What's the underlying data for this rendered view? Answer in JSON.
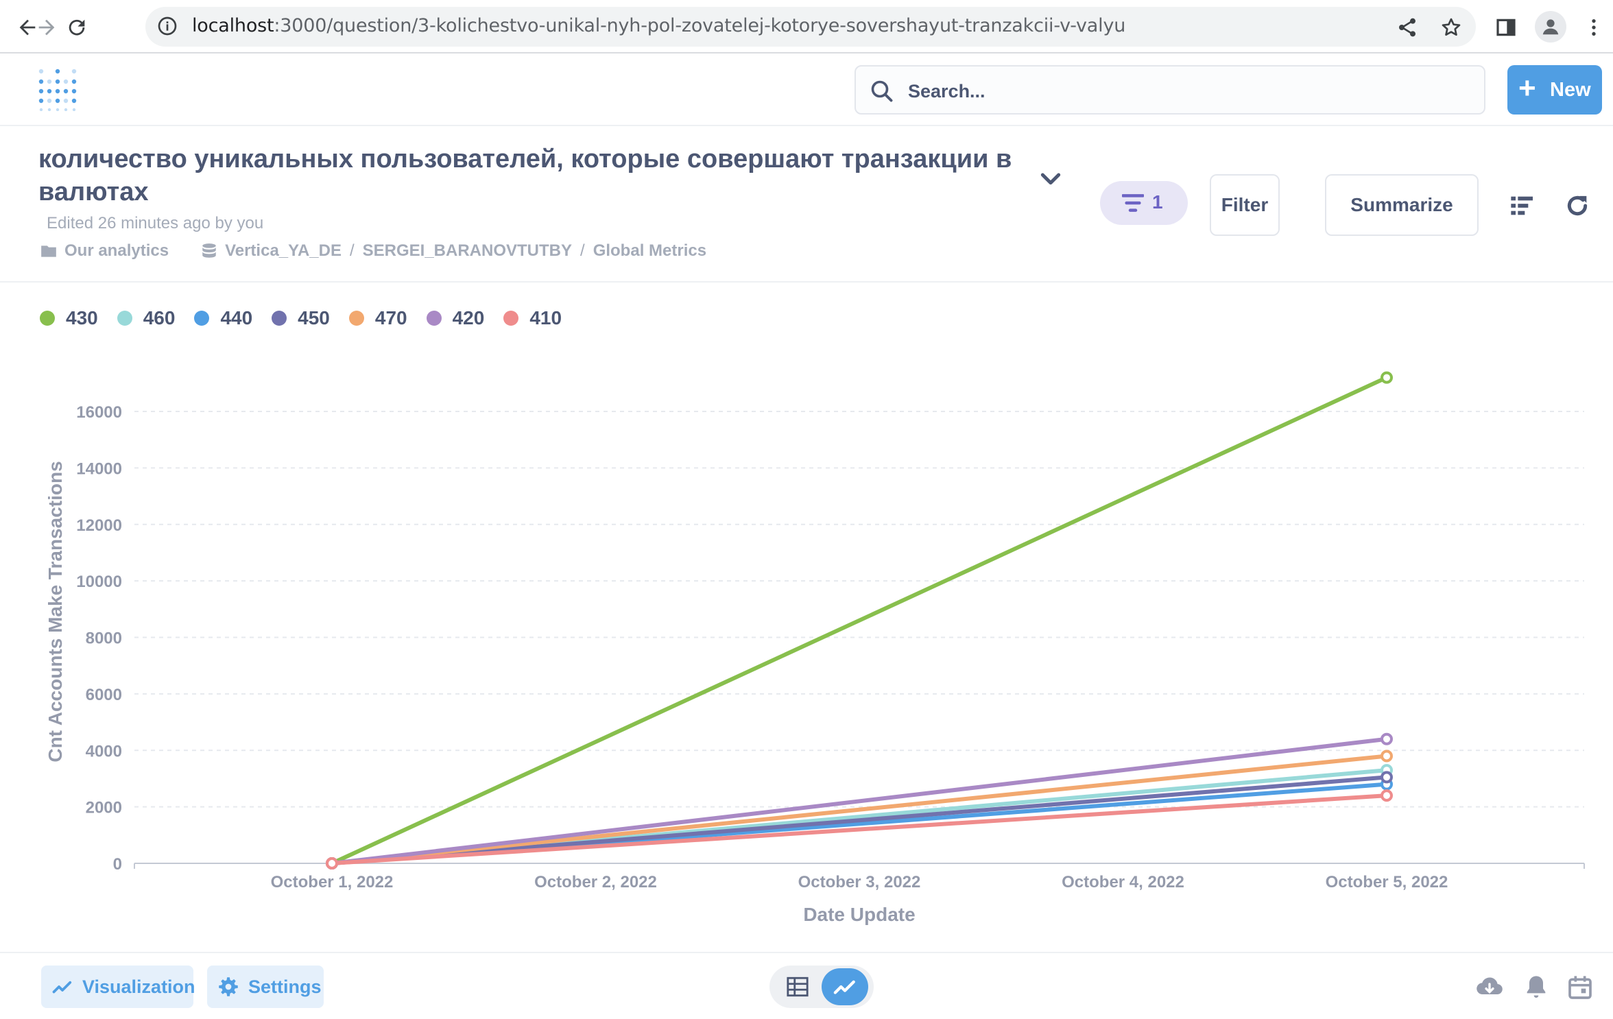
{
  "browser": {
    "url_host": "localhost",
    "url_rest": ":3000/question/3-kolichestvo-unikal-nyh-pol-zovatelej-kotorye-sovershayut-tranzakcii-v-valyu"
  },
  "app": {
    "search_placeholder": "Search...",
    "new_label": "New",
    "new_plus": "+"
  },
  "question": {
    "title": "количество уникальных пользователей, которые совершают транзакции в валютах",
    "edited": "Edited 26 minutes ago by you",
    "collection": "Our analytics",
    "database": "Vertica_YA_DE",
    "sep1": "/",
    "schema": "SERGEI_BARANOVTUTBY",
    "sep2": "/",
    "table": "Global Metrics",
    "filter_count": "1",
    "filter_label": "Filter",
    "summarize_label": "Summarize"
  },
  "footer": {
    "visualization_label": "Visualization",
    "settings_label": "Settings"
  },
  "colors": {
    "accent": "#509ee3"
  },
  "chart_data": {
    "type": "line",
    "xlabel": "Date Update",
    "ylabel": "Cnt Accounts Make Transactions",
    "categories": [
      "October 1, 2022",
      "October 2, 2022",
      "October 3, 2022",
      "October 4, 2022",
      "October 5, 2022"
    ],
    "ylim": [
      0,
      16000
    ],
    "yticks": [
      0,
      2000,
      4000,
      6000,
      8000,
      10000,
      12000,
      14000,
      16000
    ],
    "grid": true,
    "legend_position": "top-left",
    "series": [
      {
        "name": "430",
        "color": "#88bf4d",
        "x": [
          "October 1, 2022",
          "October 5, 2022"
        ],
        "values": [
          0,
          17200
        ]
      },
      {
        "name": "460",
        "color": "#98d9d9",
        "x": [
          "October 1, 2022",
          "October 5, 2022"
        ],
        "values": [
          0,
          3300
        ]
      },
      {
        "name": "440",
        "color": "#509ee3",
        "x": [
          "October 1, 2022",
          "October 5, 2022"
        ],
        "values": [
          0,
          2800
        ]
      },
      {
        "name": "450",
        "color": "#7172ad",
        "x": [
          "October 1, 2022",
          "October 5, 2022"
        ],
        "values": [
          0,
          3050
        ]
      },
      {
        "name": "470",
        "color": "#f2a86f",
        "x": [
          "October 1, 2022",
          "October 5, 2022"
        ],
        "values": [
          0,
          3800
        ]
      },
      {
        "name": "420",
        "color": "#a989c5",
        "x": [
          "October 1, 2022",
          "October 5, 2022"
        ],
        "values": [
          0,
          4400
        ]
      },
      {
        "name": "410",
        "color": "#ef8c8c",
        "x": [
          "October 1, 2022",
          "October 5, 2022"
        ],
        "values": [
          0,
          2400
        ]
      }
    ]
  }
}
